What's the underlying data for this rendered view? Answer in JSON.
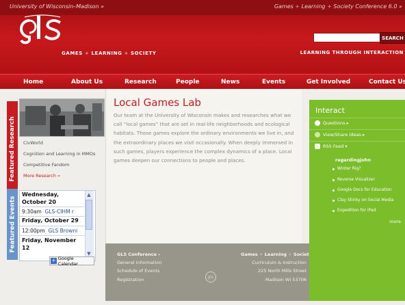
{
  "topbar": {
    "university": "University of Wisconsin–Madison »",
    "right_parts": [
      "Games",
      "Learning",
      "Society Conference 6.0 »"
    ]
  },
  "header": {
    "logo_text": "gls",
    "tagline_left": [
      "GAMES",
      "LEARNING",
      "SOCIETY"
    ],
    "search_placeholder": "",
    "search_button": "SEARCH",
    "tagline_right": "LEARNING THROUGH INTERACTION"
  },
  "nav": {
    "items": [
      "Home",
      "About Us",
      "Research",
      "People",
      "News",
      "Events",
      "Get Involved",
      "Contact Us"
    ]
  },
  "featured_research": {
    "tab_label": "Featured Research",
    "links": [
      "CivWorld",
      "Cognition and Learning in MMOs",
      "Competitive Fandom"
    ],
    "more": "More Research »"
  },
  "featured_events": {
    "tab_label": "Featured Events",
    "dates": [
      "Wednesday, October 20",
      "Friday, October 29",
      "Friday, November 12"
    ],
    "events": [
      {
        "time": "9:30am",
        "title": "GLS-CIHM r"
      },
      {
        "time": "12:00pm",
        "title": "GLS Browni"
      }
    ],
    "google_calendar": "Google Calendar"
  },
  "main": {
    "title": "Local Games Lab",
    "intro": "Our team at the University of Wisconsin makes and researches what we call “local games” that are set in real-life neighborhoods and ecological habitats. These games explore the ordinary environments we live in, and the extraordinary places we visit occasionally. When deeply immersed in such games, players experience the complex dynamics of a place. Local games deepen our connections to people and places."
  },
  "footer": {
    "left_heading": "GLS Conference ›",
    "left_links": [
      "General Information",
      "Schedule of Events",
      "Registration"
    ],
    "right_heading": [
      "Games",
      "Learning",
      "Society"
    ],
    "right_lines": [
      "Curriculum & Instruction",
      "225 North Mills Street",
      "Madison WI 53706"
    ],
    "logo": "gls"
  },
  "interact": {
    "title": "Interact",
    "items": [
      "Questions ▸",
      "View/Share Ideas ▸",
      "RSS Feed ▾"
    ],
    "blog_title": "regardingjohn",
    "blog_posts": [
      "Winter Rig?",
      "Reverse Visualizer",
      "Google Docs for Education",
      "Clay Shirky on Social Media",
      "Expedition for iPad"
    ],
    "more": "more"
  },
  "colors": {
    "brand_red": "#c71c22",
    "dark_red": "#8e0e11",
    "interact_green": "#7bbd2b",
    "events_blue": "#6a93c8"
  }
}
